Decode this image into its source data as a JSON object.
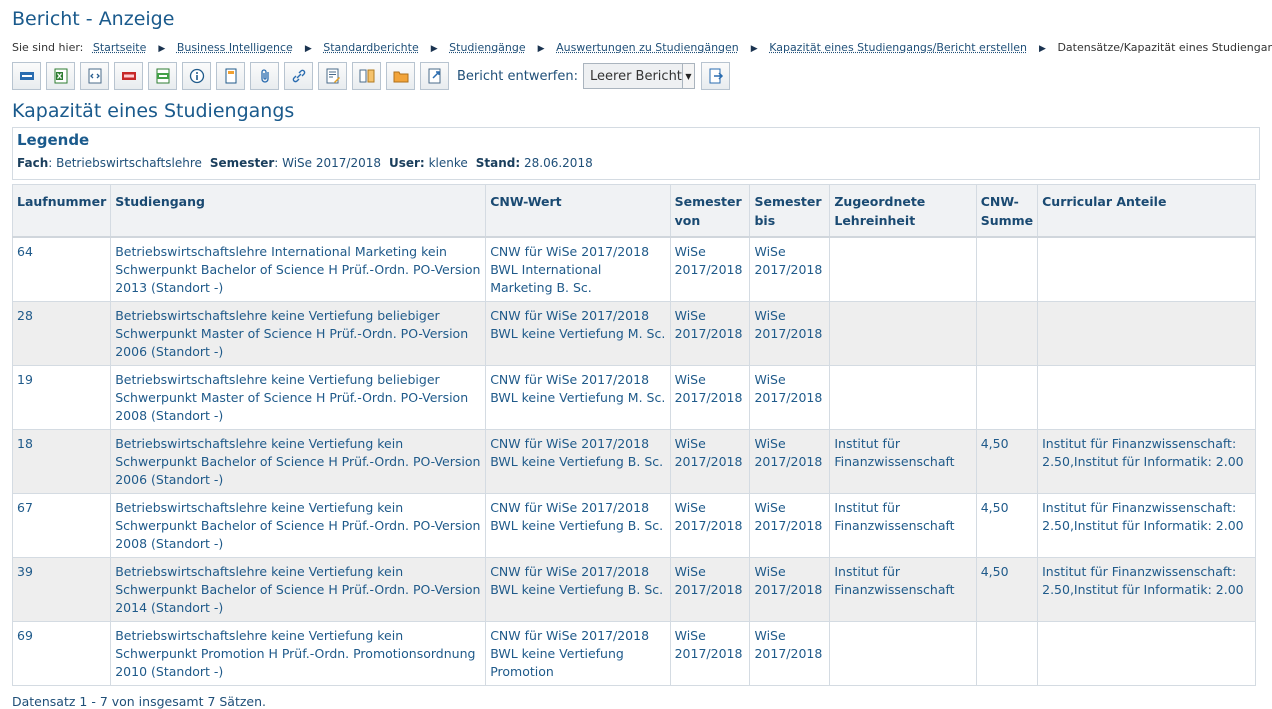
{
  "window": {
    "title": "Bericht - Anzeige"
  },
  "breadcrumb": {
    "label": "Sie sind hier:",
    "items": [
      "Startseite",
      "Business Intelligence",
      "Standardberichte",
      "Studiengänge",
      "Auswertungen zu Studiengängen",
      "Kapazität eines Studiengangs/Bericht erstellen"
    ],
    "current": "Datensätze/Kapazität eines Studiengangs"
  },
  "toolbar": {
    "buttons": [
      {
        "icon": "html-export-icon"
      },
      {
        "icon": "excel-export-icon"
      },
      {
        "icon": "xml-export-icon"
      },
      {
        "icon": "pdf-export-icon"
      },
      {
        "icon": "csv-export-icon"
      },
      {
        "icon": "info-icon"
      },
      {
        "icon": "bookmark-icon"
      },
      {
        "icon": "attachment-icon"
      },
      {
        "icon": "link-icon"
      },
      {
        "icon": "edit-report-icon"
      },
      {
        "icon": "compare-icon"
      },
      {
        "icon": "folder-icon"
      },
      {
        "icon": "export-edit-icon"
      }
    ],
    "design_label": "Bericht entwerfen:",
    "design_selected": "Leerer Bericht",
    "apply_icon": "apply-icon"
  },
  "report": {
    "title": "Kapazität eines Studiengangs",
    "legend": {
      "title": "Legende",
      "fach_label": "Fach",
      "fach_value": ": Betriebswirtschaftslehre",
      "semester_label": "Semester",
      "semester_value": ": WiSe 2017/2018",
      "user_label": "User:",
      "user_value": "klenke",
      "stand_label": "Stand:",
      "stand_value": "28.06.2018"
    },
    "columns": [
      "Laufnummer",
      "Studiengang",
      "CNW-Wert",
      "Semester von",
      "Semester bis",
      "Zugeordnete Lehreinheit",
      "CNW-Summe",
      "Curricular Anteile"
    ],
    "rows": [
      {
        "laufnummer": "64",
        "studiengang": "Betriebswirtschaftslehre International Marketing kein Schwerpunkt Bachelor of Science H Prüf.-Ordn. PO-Version 2013 (Standort -)",
        "cnw_wert": "CNW für WiSe 2017/2018 BWL International Marketing B. Sc.",
        "sem_von": "WiSe 2017/2018",
        "sem_bis": "WiSe 2017/2018",
        "lehreinheit": "",
        "cnw_summe": "",
        "anteile": ""
      },
      {
        "laufnummer": "28",
        "studiengang": "Betriebswirtschaftslehre keine Vertiefung beliebiger Schwerpunkt Master of Science H Prüf.-Ordn. PO-Version 2006 (Standort -)",
        "cnw_wert": "CNW für WiSe 2017/2018 BWL keine Vertiefung M. Sc.",
        "sem_von": "WiSe 2017/2018",
        "sem_bis": "WiSe 2017/2018",
        "lehreinheit": "",
        "cnw_summe": "",
        "anteile": ""
      },
      {
        "laufnummer": "19",
        "studiengang": "Betriebswirtschaftslehre keine Vertiefung beliebiger Schwerpunkt Master of Science H Prüf.-Ordn. PO-Version 2008 (Standort -)",
        "cnw_wert": "CNW für WiSe 2017/2018 BWL keine Vertiefung M. Sc.",
        "sem_von": "WiSe 2017/2018",
        "sem_bis": "WiSe 2017/2018",
        "lehreinheit": "",
        "cnw_summe": "",
        "anteile": ""
      },
      {
        "laufnummer": "18",
        "studiengang": "Betriebswirtschaftslehre keine Vertiefung kein Schwerpunkt Bachelor of Science H Prüf.-Ordn. PO-Version 2006 (Standort -)",
        "cnw_wert": "CNW für WiSe 2017/2018 BWL keine Vertiefung B. Sc.",
        "sem_von": "WiSe 2017/2018",
        "sem_bis": "WiSe 2017/2018",
        "lehreinheit": "Institut für Finanzwissenschaft",
        "cnw_summe": "4,50",
        "anteile": "Institut für Finanzwissenschaft: 2.50,Institut für Informatik: 2.00"
      },
      {
        "laufnummer": "67",
        "studiengang": "Betriebswirtschaftslehre keine Vertiefung kein Schwerpunkt Bachelor of Science H Prüf.-Ordn. PO-Version 2008 (Standort -)",
        "cnw_wert": "CNW für WiSe 2017/2018 BWL keine Vertiefung B. Sc.",
        "sem_von": "WiSe 2017/2018",
        "sem_bis": "WiSe 2017/2018",
        "lehreinheit": "Institut für Finanzwissenschaft",
        "cnw_summe": "4,50",
        "anteile": "Institut für Finanzwissenschaft: 2.50,Institut für Informatik: 2.00"
      },
      {
        "laufnummer": "39",
        "studiengang": "Betriebswirtschaftslehre keine Vertiefung kein Schwerpunkt Bachelor of Science H Prüf.-Ordn. PO-Version 2014 (Standort -)",
        "cnw_wert": "CNW für WiSe 2017/2018 BWL keine Vertiefung B. Sc.",
        "sem_von": "WiSe 2017/2018",
        "sem_bis": "WiSe 2017/2018",
        "lehreinheit": "Institut für Finanzwissenschaft",
        "cnw_summe": "4,50",
        "anteile": "Institut für Finanzwissenschaft: 2.50,Institut für Informatik: 2.00"
      },
      {
        "laufnummer": "69",
        "studiengang": "Betriebswirtschaftslehre keine Vertiefung kein Schwerpunkt Promotion H Prüf.-Ordn. Promotionsordnung 2010 (Standort -)",
        "cnw_wert": "CNW für WiSe 2017/2018 BWL keine Vertiefung Promotion",
        "sem_von": "WiSe 2017/2018",
        "sem_bis": "WiSe 2017/2018",
        "lehreinheit": "",
        "cnw_summe": "",
        "anteile": ""
      }
    ],
    "footer": "Datensatz 1 - 7 von insgesamt 7 Sätzen."
  }
}
